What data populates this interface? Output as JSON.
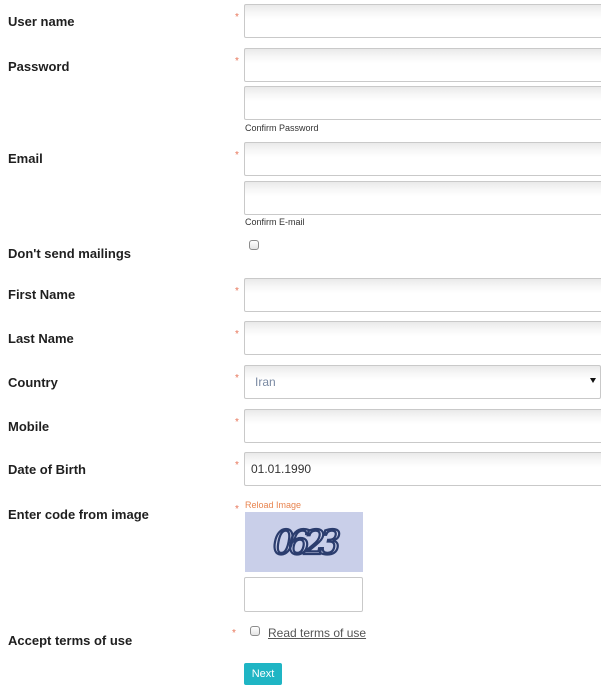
{
  "form": {
    "required_mark": "*",
    "username": {
      "label": "User name",
      "value": ""
    },
    "password": {
      "label": "Password",
      "value": "",
      "confirm_value": "",
      "confirm_hint": "Confirm Password"
    },
    "email": {
      "label": "Email",
      "value": "",
      "confirm_value": "",
      "confirm_hint": "Confirm E-mail"
    },
    "no_mailings": {
      "label": "Don't send mailings",
      "checked": false
    },
    "first_name": {
      "label": "First Name",
      "value": ""
    },
    "last_name": {
      "label": "Last Name",
      "value": ""
    },
    "country": {
      "label": "Country",
      "selected": "Iran"
    },
    "mobile": {
      "label": "Mobile",
      "value": ""
    },
    "dob": {
      "label": "Date of Birth",
      "value": "01.01.1990"
    },
    "captcha": {
      "label": "Enter code from image",
      "reload_label": "Reload Image",
      "image_text": "0623",
      "value": ""
    },
    "terms": {
      "label": "Accept terms of use",
      "link_text": "Read terms of use",
      "checked": false
    },
    "next_button": "Next"
  },
  "colors": {
    "required": "#e8765a",
    "reload_link": "#e8844f",
    "captcha_bg": "#c9cfe9",
    "captcha_ink": "#2b3d6e",
    "button_bg": "#1fb5c4",
    "select_text": "#7a8aa3"
  }
}
